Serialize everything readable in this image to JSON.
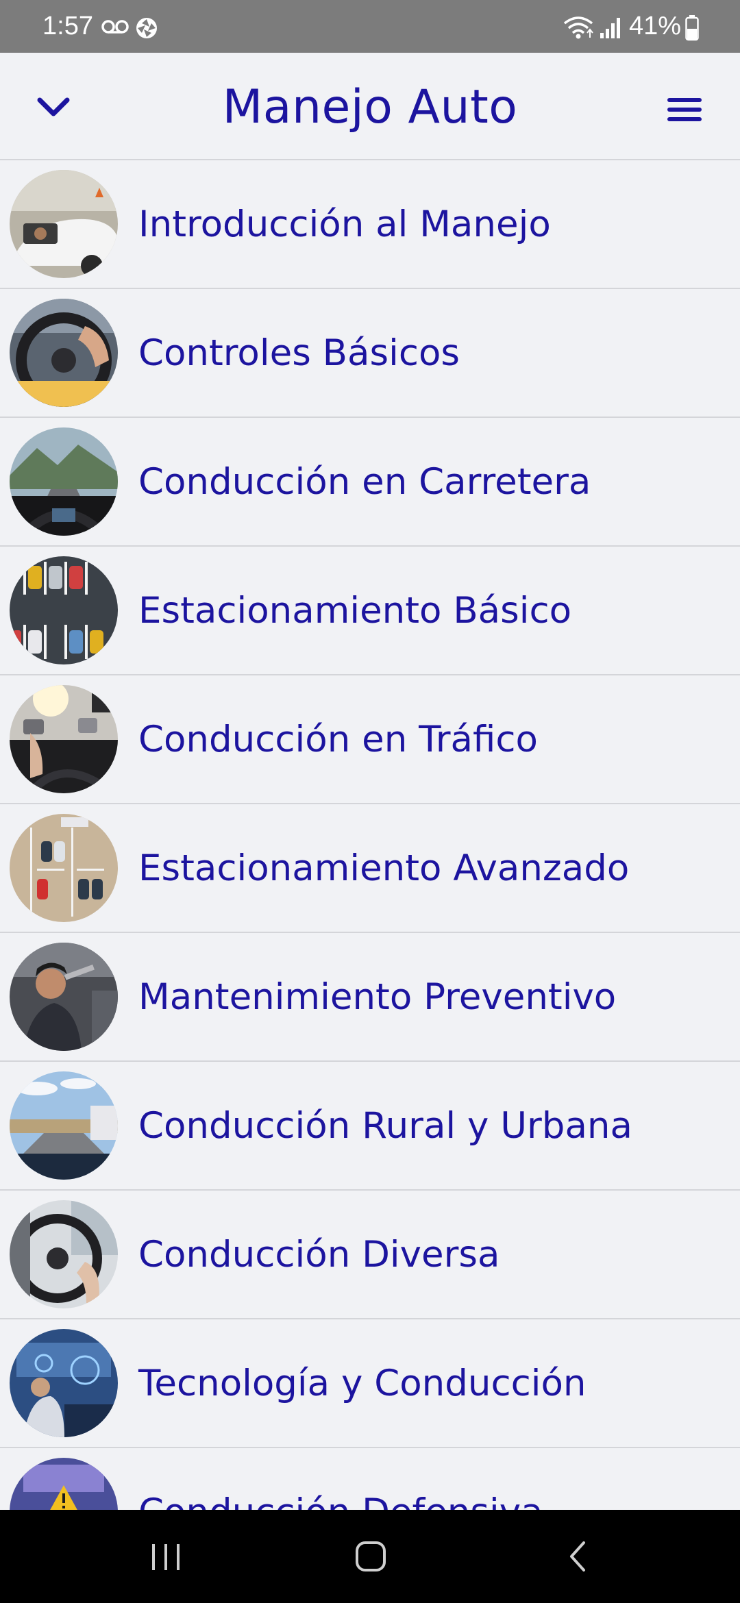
{
  "status_bar": {
    "time": "1:57",
    "battery": "41%",
    "icons": [
      "voicemail-icon",
      "aperture-icon",
      "wifi-icon",
      "signal-icon",
      "battery-icon"
    ]
  },
  "header": {
    "title": "Manejo Auto",
    "left_icon": "chevron-down-icon",
    "right_icon": "hamburger-menu-icon"
  },
  "topics": [
    {
      "label": "Introducción al Manejo"
    },
    {
      "label": "Controles Básicos"
    },
    {
      "label": "Conducción en Carretera"
    },
    {
      "label": "Estacionamiento Básico"
    },
    {
      "label": "Conducción en Tráfico"
    },
    {
      "label": "Estacionamiento Avanzado"
    },
    {
      "label": "Mantenimiento Preventivo"
    },
    {
      "label": "Conducción Rural y Urbana"
    },
    {
      "label": "Conducción Diversa"
    },
    {
      "label": "Tecnología y Conducción"
    },
    {
      "label": "Conducción Defensiva"
    }
  ],
  "nav_bar": {
    "icons": [
      "recent-apps-icon",
      "home-icon",
      "back-icon"
    ]
  },
  "colors": {
    "accent": "#1c149f",
    "background": "#f1f2f5",
    "status_bar": "#7c7c7c",
    "divider": "#d4d5d9"
  }
}
